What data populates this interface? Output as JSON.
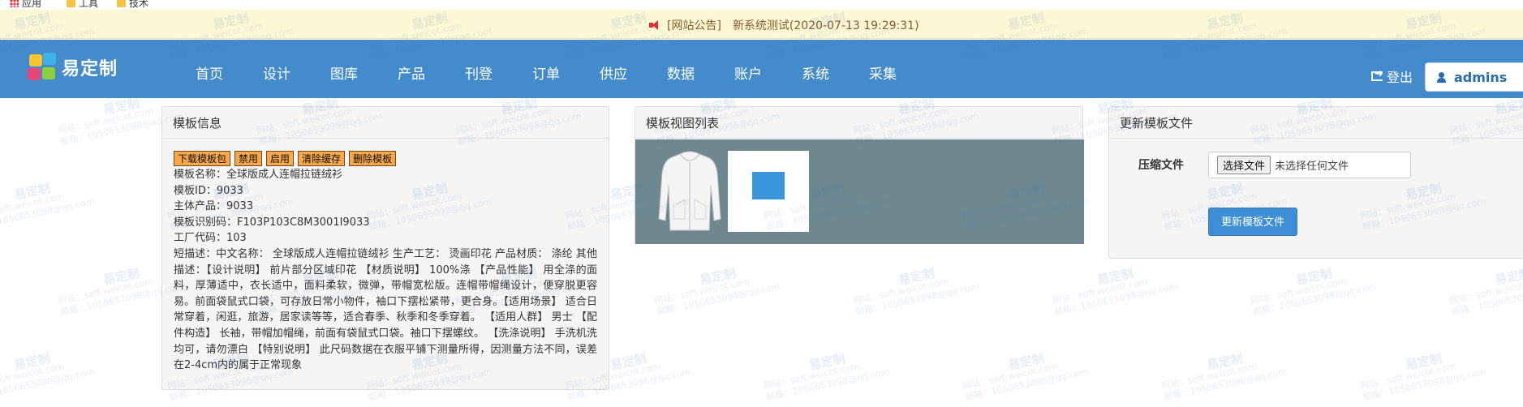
{
  "bookmarks": [
    {
      "label": "应用",
      "icon": "apps-icon"
    },
    {
      "label": "工具",
      "icon": "folder-icon"
    },
    {
      "label": "技术",
      "icon": "folder-icon"
    }
  ],
  "announcement": {
    "label": "[网站公告]",
    "text": "新系统测试(2020-07-13 19:29:31)",
    "icon": "speaker-icon"
  },
  "navbar": {
    "brand": "易定制",
    "menu": [
      "首页",
      "设计",
      "图库",
      "产品",
      "刊登",
      "订单",
      "供应",
      "数据",
      "账户",
      "系统",
      "采集"
    ],
    "logout": "登出",
    "user": "admins",
    "bg_color": "#438bca"
  },
  "template_info": {
    "title": "模板信息",
    "buttons": [
      "下载模板包",
      "禁用",
      "启用",
      "清除缓存",
      "删除模板"
    ],
    "rows": [
      "模板名称：全球版成人连帽拉链绒衫",
      "模板ID：9033",
      "主体产品：9033",
      "模板识别码：F103P103C8M3001I9033",
      "工厂代码：103"
    ],
    "description": "短描述：中文名称： 全球版成人连帽拉链绒衫 生产工艺： 烫画印花 产品材质： 涤纶 其他描述：【设计说明】 前片部分区域印花 【材质说明】 100%涤 【产品性能】 用全涤的面料，厚薄适中，衣长适中，面料柔软，微弹，带帽宽松版。连帽带帽绳设计，便穿脱更容易。前面袋鼠式口袋，可存放日常小物件，袖口下摆松紧带，更合身。【适用场景】 适合日常穿着，闲逛，旅游，居家读等等，适合春季、秋季和冬季穿着。 【适用人群】 男士 【配件构造】 长袖，带帽加帽绳，前面有袋鼠式口袋。袖口下摆螺纹。 【洗涤说明】 手洗机洗均可，请勿漂白 【特别说明】 此尺码数据在衣服平铺下测量所得，因测量方法不同，误差在2-4cm内的属于正常现象"
  },
  "view_list": {
    "title": "模板视图列表"
  },
  "update_file": {
    "title": "更新模板文件",
    "field_label": "压缩文件",
    "choose_btn": "选择文件",
    "no_file": "未选择任何文件",
    "submit": "更新模板文件"
  },
  "watermark": {
    "brand": "易定制",
    "site": "网站：soft.weicot.com",
    "email": "邮箱：1050653098@qq.com"
  }
}
